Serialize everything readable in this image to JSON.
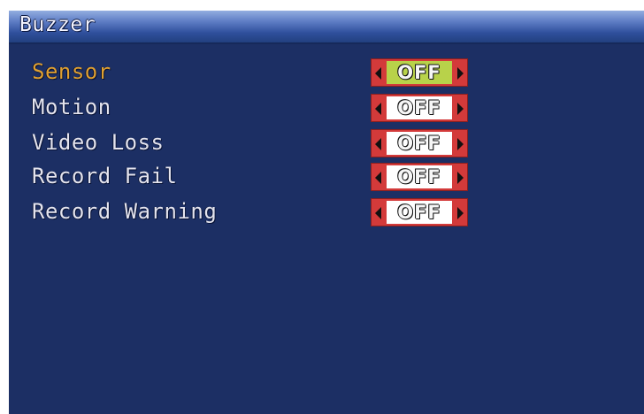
{
  "window": {
    "title": "Buzzer"
  },
  "settings": [
    {
      "label": "Sensor",
      "value": "OFF",
      "selected": true
    },
    {
      "label": "Motion",
      "value": "OFF",
      "selected": false
    },
    {
      "label": "Video Loss",
      "value": "OFF",
      "selected": false
    },
    {
      "label": "Record Fail",
      "value": "OFF",
      "selected": false
    },
    {
      "label": "Record Warning",
      "value": "OFF",
      "selected": false
    }
  ],
  "colors": {
    "background": "#1c2f64",
    "selected_label": "#e0a030",
    "label": "#e4e4ee",
    "toggle_frame": "#d33a3a",
    "selected_value_bg": "#b8d24a"
  },
  "icons": {
    "decrease": "triangle-left-icon",
    "increase": "triangle-right-icon"
  }
}
